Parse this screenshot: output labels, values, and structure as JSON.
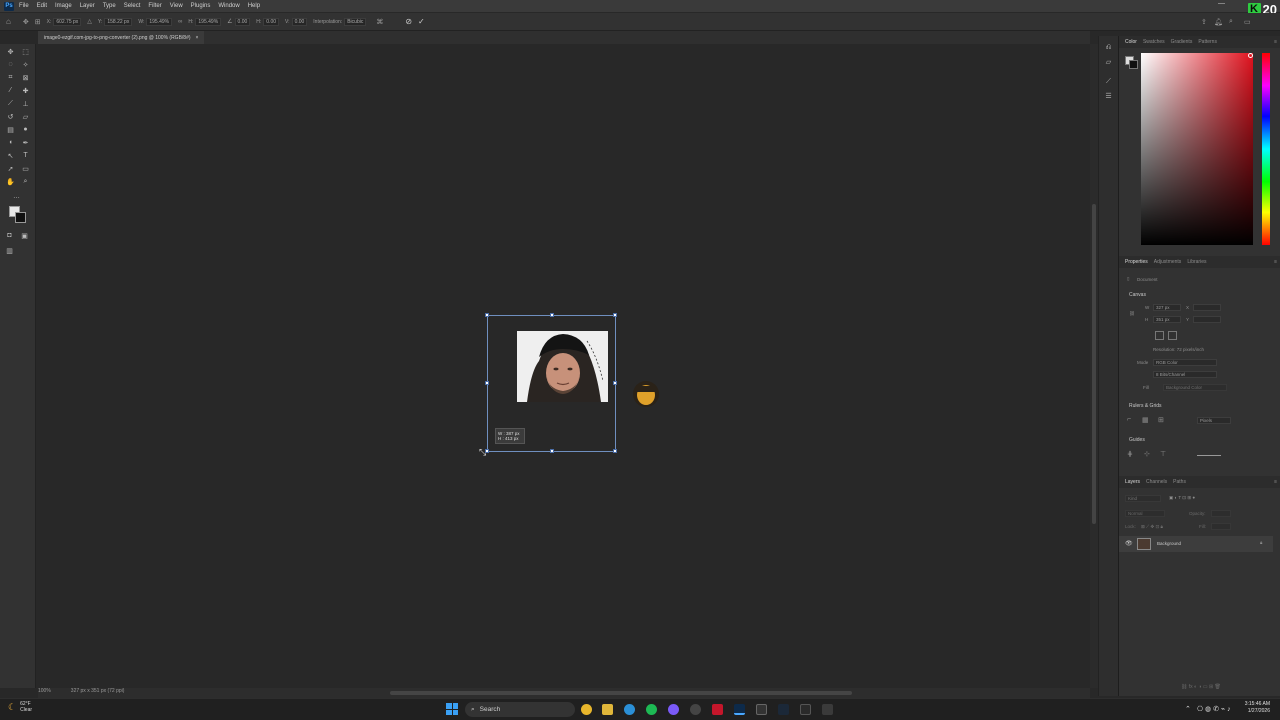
{
  "menubar": {
    "app_icon": "Ps",
    "items": [
      "File",
      "Edit",
      "Image",
      "Layer",
      "Type",
      "Select",
      "Filter",
      "View",
      "Plugins",
      "Window",
      "Help"
    ],
    "brand_letter": "K",
    "brand_number": "20"
  },
  "options_bar": {
    "x_label": "X:",
    "x_value": "602.75 px",
    "y_label": "Y:",
    "y_value": "158.22 px",
    "w_label": "W:",
    "w_value": "195.49%",
    "h_label": "H:",
    "h_value": "195.49%",
    "angle_value": "0.00",
    "h_skew_label": "H:",
    "h_skew_value": "0.00",
    "v_skew_label": "V:",
    "v_skew_value": "0.00",
    "interpolation_label": "Interpolation:",
    "interpolation_value": "Bicubic"
  },
  "document": {
    "tab_title": "image0-ezgif.com-jpg-to-png-converter (2).png @ 100% (RGB/8#)",
    "zoom": "100%",
    "size_info": "327 px x 351 px (72 ppi)"
  },
  "transform_tooltip": {
    "w_text": "W : 387 px",
    "h_text": "H : 413 px"
  },
  "color_panel": {
    "tabs": [
      "Color",
      "Swatches",
      "Gradients",
      "Patterns"
    ],
    "active_tab": "Color",
    "hue_color": "#e0121e"
  },
  "properties_panel": {
    "tabs": [
      "Properties",
      "Adjustments",
      "Libraries"
    ],
    "document_label": "Document",
    "canvas_title": "Canvas",
    "w_label": "W",
    "w_value": "327 px",
    "h_label": "H",
    "h_value": "351 px",
    "x_label": "X",
    "y_label": "Y",
    "resolution": "Resolution: 72 pixels/inch",
    "mode_label": "Mode",
    "mode_value": "RGB Color",
    "depth_value": "8 Bits/Channel",
    "fill_label": "Fill",
    "fill_value": "Background Color",
    "rulers_title": "Rulers & Grids",
    "rulers_unit": "Pixels",
    "guides_title": "Guides"
  },
  "layers_panel": {
    "tabs": [
      "Layers",
      "Channels",
      "Paths"
    ],
    "search_placeholder": "Kind",
    "blend_mode": "Normal",
    "opacity_label": "Opacity:",
    "lock_label": "Lock:",
    "fill_label": "Fill:",
    "layer_name": "Background"
  },
  "taskbar": {
    "temperature": "62°F",
    "weather": "Clear",
    "search_label": "Search",
    "time": "3:15:46 AM",
    "date": "1/27/2026"
  }
}
